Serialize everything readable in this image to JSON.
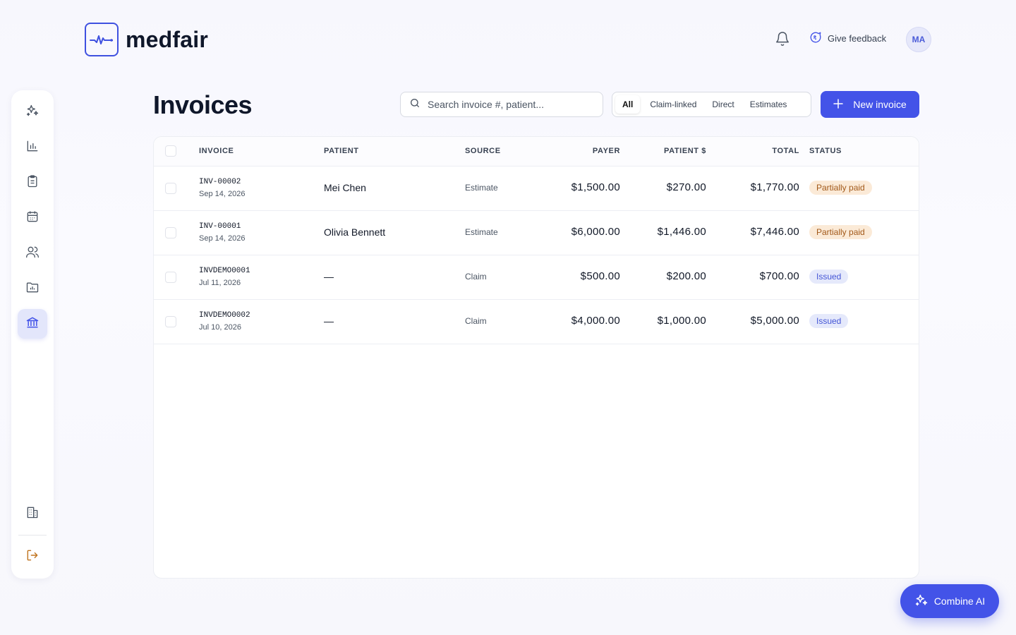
{
  "brand": {
    "name": "medfair",
    "accent": "#4353e8"
  },
  "header": {
    "feedback_label": "Give feedback",
    "avatar_initials": "MA"
  },
  "sidebar": {
    "items": [
      {
        "icon": "sparkle-icon",
        "active": false
      },
      {
        "icon": "bar-chart-icon",
        "active": false
      },
      {
        "icon": "clipboard-icon",
        "active": false
      },
      {
        "icon": "calendar-icon",
        "active": false
      },
      {
        "icon": "users-icon",
        "active": false
      },
      {
        "icon": "folder-chart-icon",
        "active": false
      },
      {
        "icon": "bank-icon",
        "active": true
      }
    ],
    "bottom": [
      {
        "icon": "building-icon"
      },
      {
        "icon": "logout-icon"
      }
    ]
  },
  "page": {
    "title": "Invoices"
  },
  "search": {
    "placeholder": "Search invoice #, patient..."
  },
  "filters": {
    "all": "All",
    "claim_linked": "Claim-linked",
    "direct": "Direct",
    "estimates": "Estimates",
    "selected": "All"
  },
  "new_invoice_label": "New invoice",
  "table": {
    "headers": {
      "invoice": "INVOICE",
      "patient": "PATIENT",
      "source": "SOURCE",
      "payer": "PAYER",
      "patient_amt": "PATIENT $",
      "total": "TOTAL",
      "status": "STATUS"
    },
    "rows": [
      {
        "number": "INV-00002",
        "date": "Sep 14, 2026",
        "patient": "Mei Chen",
        "source": "Estimate",
        "payer": "$1,500.00",
        "patient_amt": "$270.00",
        "total": "$1,770.00",
        "status": "Partially paid"
      },
      {
        "number": "INV-00001",
        "date": "Sep 14, 2026",
        "patient": "Olivia Bennett",
        "source": "Estimate",
        "payer": "$6,000.00",
        "patient_amt": "$1,446.00",
        "total": "$7,446.00",
        "status": "Partially paid"
      },
      {
        "number": "INVDEMO0001",
        "date": "Jul 11, 2026",
        "patient": "—",
        "source": "Claim",
        "payer": "$500.00",
        "patient_amt": "$200.00",
        "total": "$700.00",
        "status": "Issued"
      },
      {
        "number": "INVDEMO0002",
        "date": "Jul 10, 2026",
        "patient": "—",
        "source": "Claim",
        "payer": "$4,000.00",
        "patient_amt": "$1,000.00",
        "total": "$5,000.00",
        "status": "Issued"
      }
    ]
  },
  "ai_button_label": "Combine AI",
  "colors": {
    "partial_bg": "#fbead7",
    "partial_fg": "#a2591a",
    "issued_bg": "#e5e9fb",
    "issued_fg": "#4556d6"
  }
}
